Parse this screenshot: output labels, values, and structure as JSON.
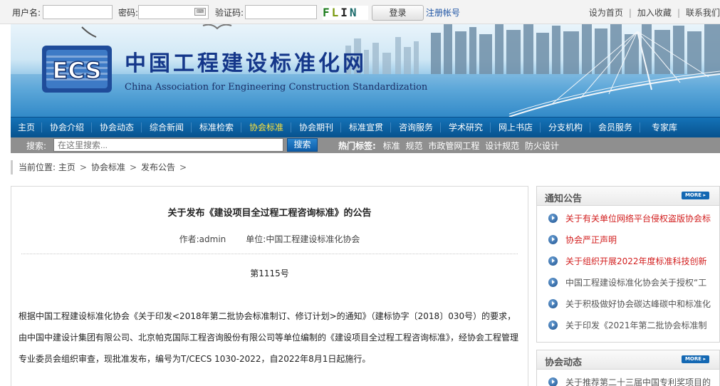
{
  "topbar": {
    "username_label": "用户名:",
    "password_label": "密码:",
    "keyboard_icon": "keyboard-icon",
    "captcha_label": "验证码:",
    "captcha_text": [
      "F",
      "L",
      "I",
      "N"
    ],
    "login_button": "登录",
    "register_link": "注册帐号",
    "links": [
      "设为首页",
      "加入收藏",
      "联系我们"
    ]
  },
  "banner": {
    "logo_text": "ECS",
    "site_name_cn": "中国工程建设标准化网",
    "site_name_en": "China Association for Engineering Construction Standardization"
  },
  "nav": {
    "items": [
      "主页",
      "协会介绍",
      "协会动态",
      "综合新闻",
      "标准检索",
      "协会标准",
      "协会期刊",
      "标准宣贯",
      "咨询服务",
      "学术研究",
      "网上书店",
      "分支机构",
      "会员服务",
      "专家库"
    ],
    "active_index": 5
  },
  "search": {
    "label": "搜索:",
    "placeholder": "在这里搜索...",
    "button": "搜索",
    "hot_label": "热门标签:",
    "hot_tags": [
      "标准",
      "规范",
      "市政管网工程",
      "设计规范",
      "防火设计"
    ]
  },
  "breadcrumb": {
    "prefix": "当前位置:",
    "items": [
      "主页",
      "协会标准",
      "发布公告"
    ]
  },
  "article": {
    "title": "关于发布《建设项目全过程工程咨询标准》的公告",
    "author": "作者:admin",
    "unit": "单位:中国工程建设标准化协会",
    "number": "第1115号",
    "paragraph_lines": [
      "根据中国工程建设标准化协会《关于印发<2018年第二批协会标准制订、修订计划>的通知》（建标协字〔2018〕030号）的要求，",
      "由中国中建设计集团有限公司、北京帕克国际工程咨询股份有限公司等单位编制的《建设项目全过程工程咨询标准》，经协会工程管理",
      "专业委员会组织审查，现批准发布，编号为T/CECS 1030-2022，自2022年8月1日起施行。"
    ]
  },
  "sidebar": {
    "notices": {
      "title": "通知公告",
      "more": "MORE",
      "items": [
        {
          "text": "关于有关单位网络平台侵权盗版协会标",
          "color": "red"
        },
        {
          "text": "协会严正声明",
          "color": "red"
        },
        {
          "text": "关于组织开展2022年度标准科技创新",
          "color": "red"
        },
        {
          "text": "中国工程建设标准化协会关于授权“工",
          "color": "gray"
        },
        {
          "text": "关于积极做好协会碳达峰碳中和标准化",
          "color": "gray"
        },
        {
          "text": "关于印发《2021年第二批协会标准制",
          "color": "gray"
        }
      ]
    },
    "news": {
      "title": "协会动态",
      "more": "MORE",
      "items": [
        {
          "text": "关于推荐第二十三届中国专利奖项目的",
          "color": "gray"
        }
      ]
    }
  }
}
